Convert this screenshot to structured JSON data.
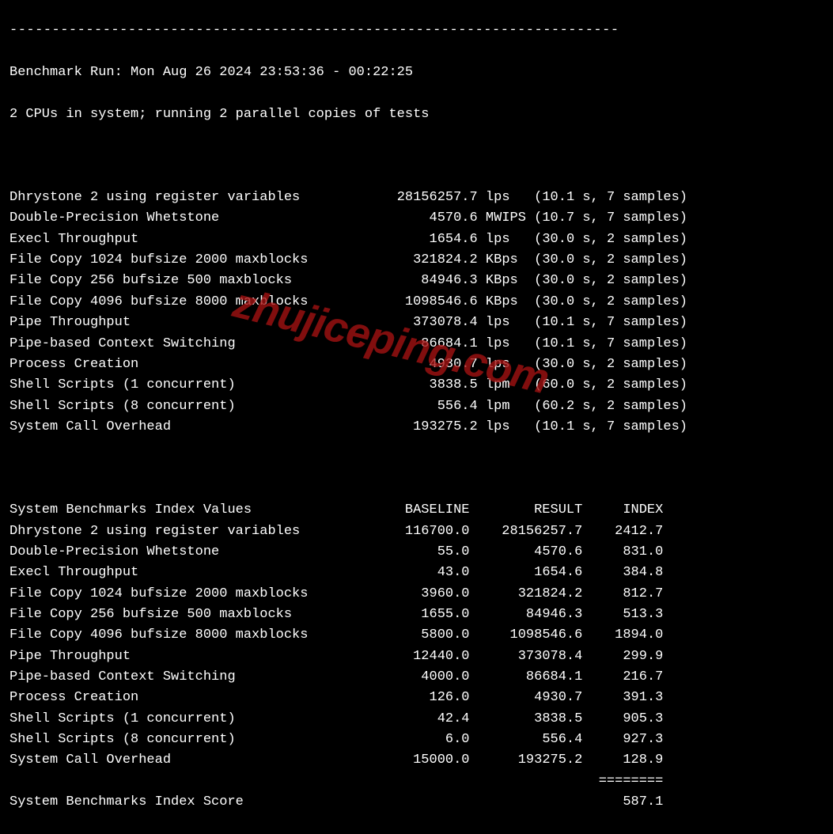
{
  "dashes": "------------------------------------------------------------------------",
  "header": {
    "run_line": "Benchmark Run: Mon Aug 26 2024 23:53:36 - 00:22:25",
    "cpu_line": "2 CPUs in system; running 2 parallel copies of tests"
  },
  "results": [
    {
      "name": "Dhrystone 2 using register variables",
      "value": "28156257.7",
      "unit": "lps",
      "time": "10.1 s",
      "samples": "7 samples"
    },
    {
      "name": "Double-Precision Whetstone",
      "value": "4570.6",
      "unit": "MWIPS",
      "time": "10.7 s",
      "samples": "7 samples"
    },
    {
      "name": "Execl Throughput",
      "value": "1654.6",
      "unit": "lps",
      "time": "30.0 s",
      "samples": "2 samples"
    },
    {
      "name": "File Copy 1024 bufsize 2000 maxblocks",
      "value": "321824.2",
      "unit": "KBps",
      "time": "30.0 s",
      "samples": "2 samples"
    },
    {
      "name": "File Copy 256 bufsize 500 maxblocks",
      "value": "84946.3",
      "unit": "KBps",
      "time": "30.0 s",
      "samples": "2 samples"
    },
    {
      "name": "File Copy 4096 bufsize 8000 maxblocks",
      "value": "1098546.6",
      "unit": "KBps",
      "time": "30.0 s",
      "samples": "2 samples"
    },
    {
      "name": "Pipe Throughput",
      "value": "373078.4",
      "unit": "lps",
      "time": "10.1 s",
      "samples": "7 samples"
    },
    {
      "name": "Pipe-based Context Switching",
      "value": "86684.1",
      "unit": "lps",
      "time": "10.1 s",
      "samples": "7 samples"
    },
    {
      "name": "Process Creation",
      "value": "4930.7",
      "unit": "lps",
      "time": "30.0 s",
      "samples": "2 samples"
    },
    {
      "name": "Shell Scripts (1 concurrent)",
      "value": "3838.5",
      "unit": "lpm",
      "time": "60.0 s",
      "samples": "2 samples"
    },
    {
      "name": "Shell Scripts (8 concurrent)",
      "value": "556.4",
      "unit": "lpm",
      "time": "60.2 s",
      "samples": "2 samples"
    },
    {
      "name": "System Call Overhead",
      "value": "193275.2",
      "unit": "lps",
      "time": "10.1 s",
      "samples": "7 samples"
    }
  ],
  "index": {
    "header": {
      "title": "System Benchmarks Index Values",
      "baseline": "BASELINE",
      "result": "RESULT",
      "index": "INDEX"
    },
    "rows": [
      {
        "name": "Dhrystone 2 using register variables",
        "baseline": "116700.0",
        "result": "28156257.7",
        "index": "2412.7"
      },
      {
        "name": "Double-Precision Whetstone",
        "baseline": "55.0",
        "result": "4570.6",
        "index": "831.0"
      },
      {
        "name": "Execl Throughput",
        "baseline": "43.0",
        "result": "1654.6",
        "index": "384.8"
      },
      {
        "name": "File Copy 1024 bufsize 2000 maxblocks",
        "baseline": "3960.0",
        "result": "321824.2",
        "index": "812.7"
      },
      {
        "name": "File Copy 256 bufsize 500 maxblocks",
        "baseline": "1655.0",
        "result": "84946.3",
        "index": "513.3"
      },
      {
        "name": "File Copy 4096 bufsize 8000 maxblocks",
        "baseline": "5800.0",
        "result": "1098546.6",
        "index": "1894.0"
      },
      {
        "name": "Pipe Throughput",
        "baseline": "12440.0",
        "result": "373078.4",
        "index": "299.9"
      },
      {
        "name": "Pipe-based Context Switching",
        "baseline": "4000.0",
        "result": "86684.1",
        "index": "216.7"
      },
      {
        "name": "Process Creation",
        "baseline": "126.0",
        "result": "4930.7",
        "index": "391.3"
      },
      {
        "name": "Shell Scripts (1 concurrent)",
        "baseline": "42.4",
        "result": "3838.5",
        "index": "905.3"
      },
      {
        "name": "Shell Scripts (8 concurrent)",
        "baseline": "6.0",
        "result": "556.4",
        "index": "927.3"
      },
      {
        "name": "System Call Overhead",
        "baseline": "15000.0",
        "result": "193275.2",
        "index": "128.9"
      }
    ],
    "divider": "========",
    "score": {
      "label": "System Benchmarks Index Score",
      "value": "587.1"
    }
  },
  "watermark": "zhujiceping.com"
}
